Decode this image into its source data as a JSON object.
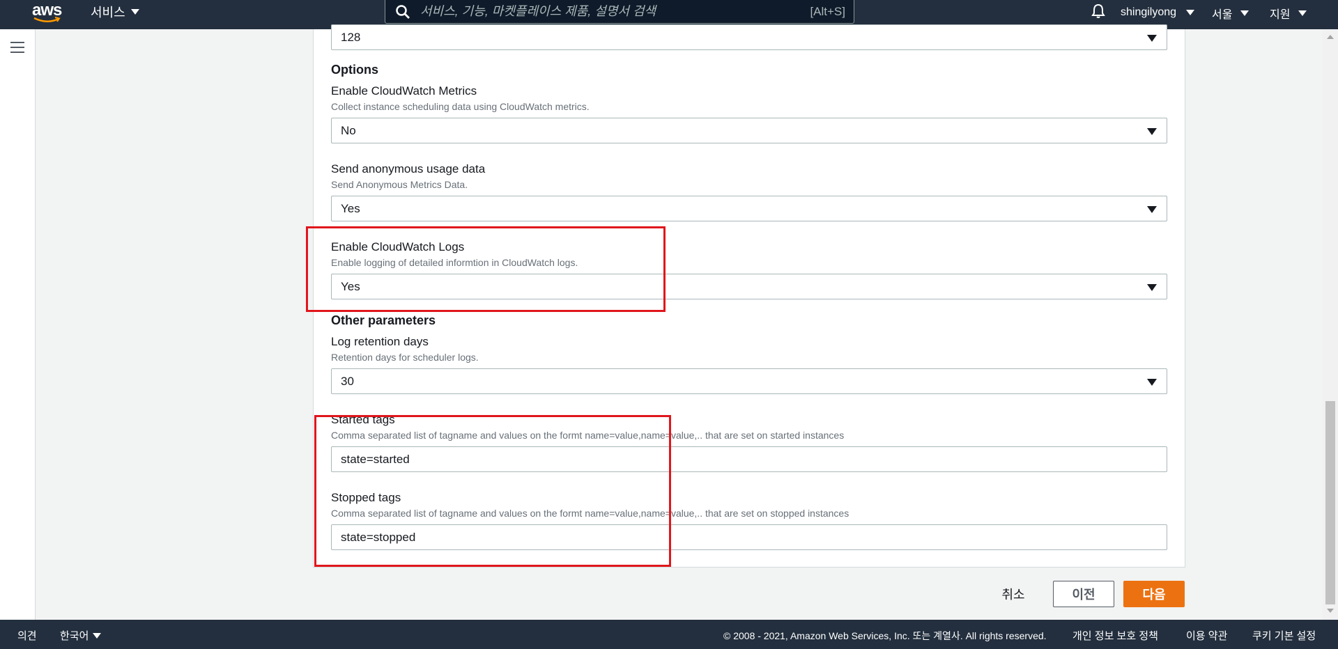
{
  "topbar": {
    "logo_text": "aws",
    "services_label": "서비스",
    "search_placeholder": "서비스, 기능, 마켓플레이스 제품, 설명서 검색",
    "search_shortcut": "[Alt+S]",
    "username": "shingilyong",
    "region": "서울",
    "support": "지원"
  },
  "form": {
    "top_select_value": "128",
    "options_heading": "Options",
    "cloudwatch_metrics": {
      "label": "Enable CloudWatch Metrics",
      "description": "Collect instance scheduling data using CloudWatch metrics.",
      "value": "No"
    },
    "anonymous_usage": {
      "label": "Send anonymous usage data",
      "description": "Send Anonymous Metrics Data.",
      "value": "Yes"
    },
    "cloudwatch_logs": {
      "label": "Enable CloudWatch Logs",
      "description": "Enable logging of detailed informtion in CloudWatch logs.",
      "value": "Yes"
    },
    "other_heading": "Other parameters",
    "log_retention": {
      "label": "Log retention days",
      "description": "Retention days for scheduler logs.",
      "value": "30"
    },
    "started_tags": {
      "label": "Started tags",
      "description": "Comma separated list of tagname and values on the formt name=value,name=value,.. that are set on started instances",
      "value": "state=started"
    },
    "stopped_tags": {
      "label": "Stopped tags",
      "description": "Comma separated list of tagname and values on the formt name=value,name=value,.. that are set on stopped instances",
      "value": "state=stopped"
    }
  },
  "actions": {
    "cancel": "취소",
    "previous": "이전",
    "next": "다음"
  },
  "footer": {
    "feedback": "의견",
    "language": "한국어",
    "copyright": "© 2008 - 2021, Amazon Web Services, Inc. 또는 계열사. All rights reserved.",
    "privacy": "개인 정보 보호 정책",
    "terms": "이용 약관",
    "cookies": "쿠키 기본 설정"
  },
  "colors": {
    "nav_bg": "#232f3e",
    "primary_button": "#ec7211",
    "highlight": "#e0161c"
  }
}
